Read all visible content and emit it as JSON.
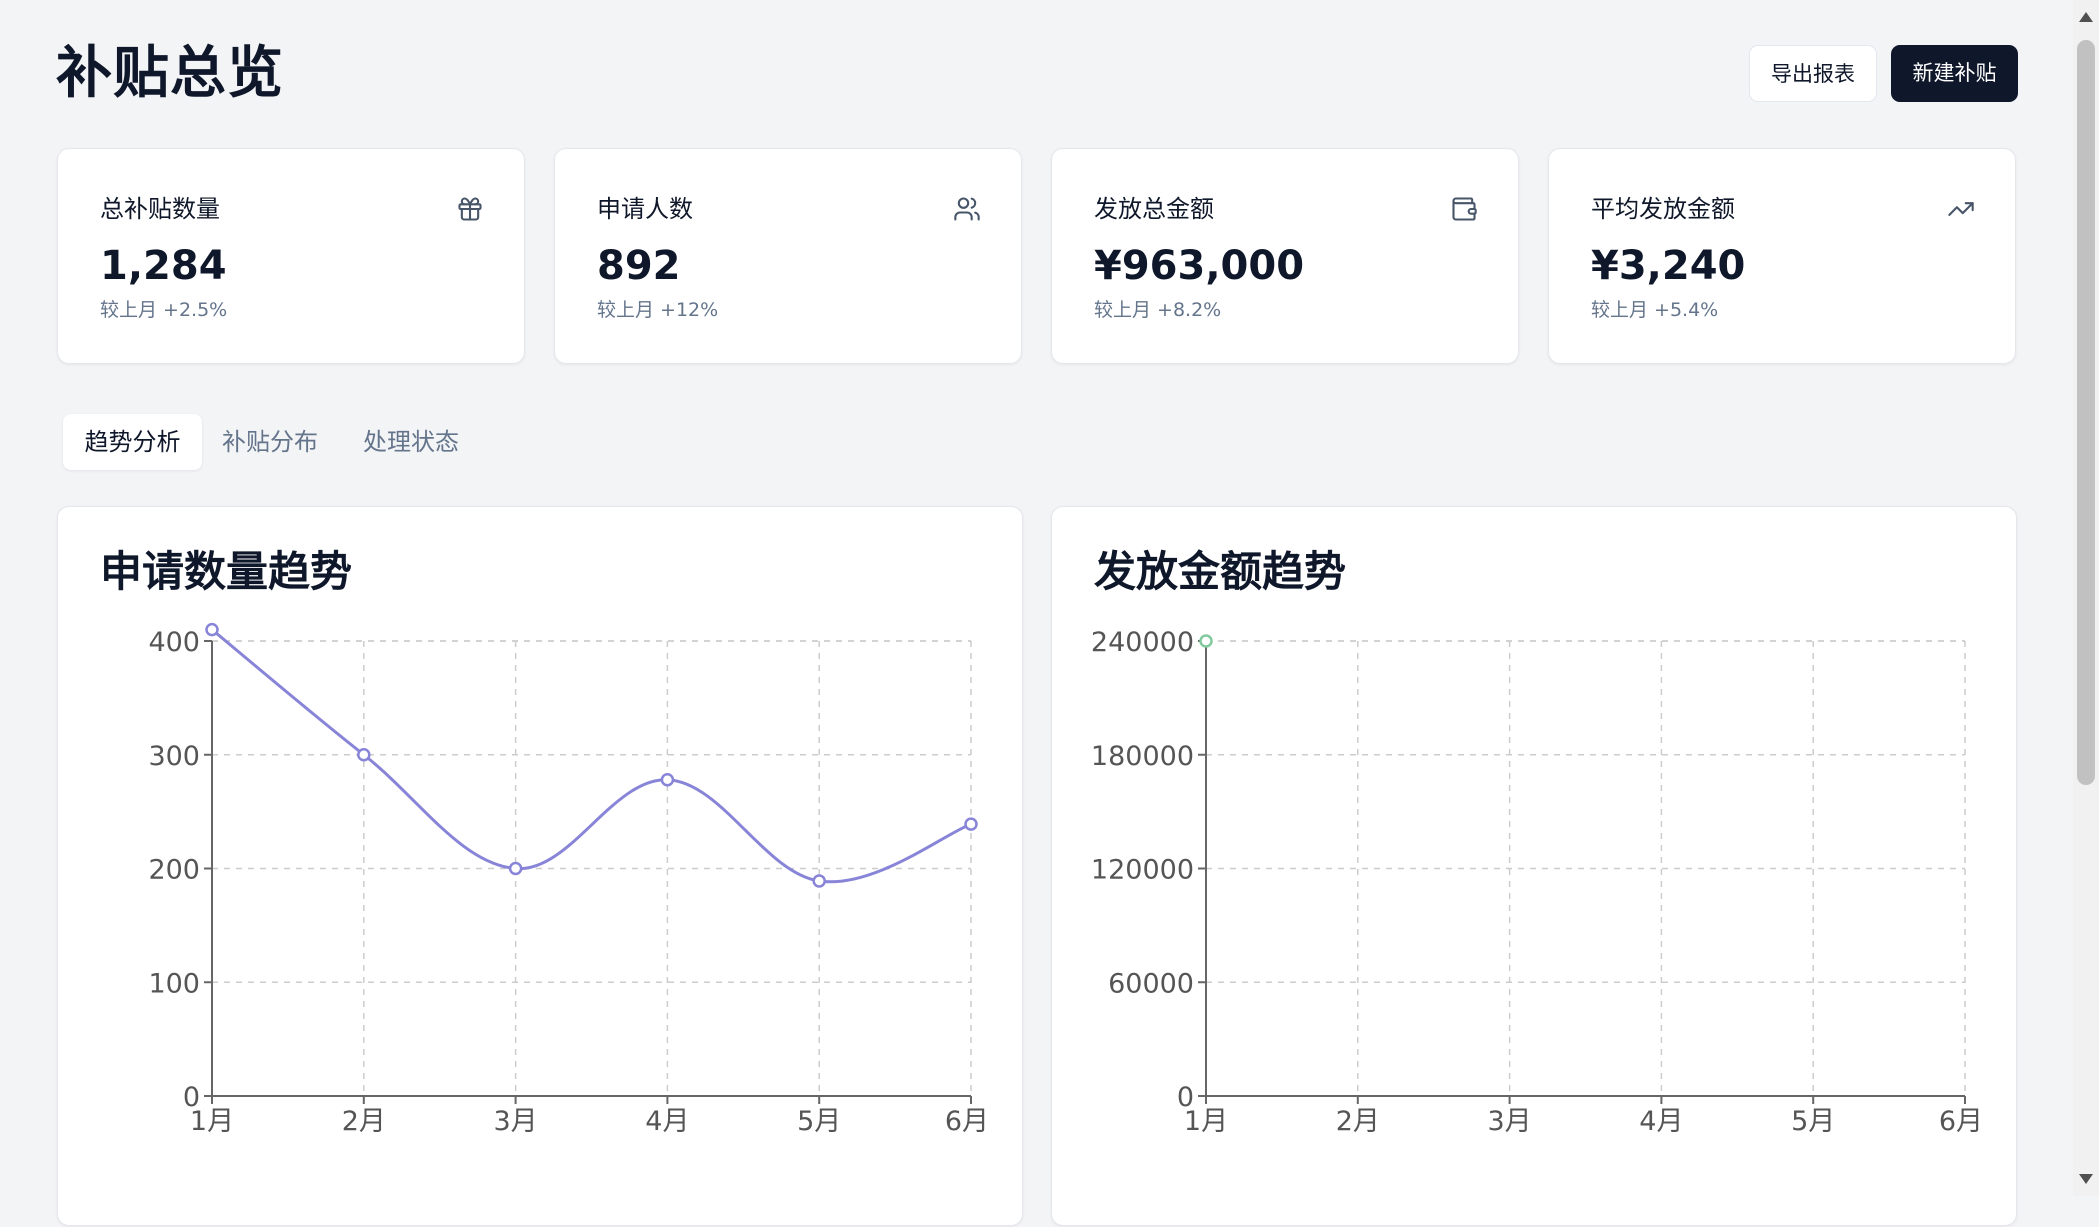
{
  "header": {
    "title": "补贴总览",
    "export_label": "导出报表",
    "new_label": "新建补贴"
  },
  "stats": [
    {
      "label": "总补贴数量",
      "value": "1,284",
      "sub": "较上月 +2.5%",
      "icon": "gift-icon"
    },
    {
      "label": "申请人数",
      "value": "892",
      "sub": "较上月 +12%",
      "icon": "users-icon"
    },
    {
      "label": "发放总金额",
      "value": "¥963,000",
      "sub": "较上月 +8.2%",
      "icon": "wallet-icon"
    },
    {
      "label": "平均发放金额",
      "value": "¥3,240",
      "sub": "较上月 +5.4%",
      "icon": "trending-up-icon"
    }
  ],
  "tabs": [
    {
      "label": "趋势分析",
      "active": true
    },
    {
      "label": "补贴分布",
      "active": false
    },
    {
      "label": "处理状态",
      "active": false
    }
  ],
  "colors": {
    "primary": "#0f172a",
    "muted": "#64748b",
    "series_applications": "#8884d8",
    "series_amount": "#82ca9d"
  },
  "chart_data": [
    {
      "type": "line",
      "title": "申请数量趋势",
      "x": [
        "1月",
        "2月",
        "3月",
        "4月",
        "5月",
        "6月"
      ],
      "series": [
        {
          "values": [
            410,
            300,
            200,
            278,
            189,
            239
          ]
        }
      ],
      "yticks": [
        0,
        100,
        200,
        300,
        400
      ],
      "ylim": [
        0,
        400
      ],
      "grid": true,
      "curve": "smooth"
    },
    {
      "type": "line",
      "title": "发放金额趋势",
      "x": [
        "1月",
        "2月",
        "3月",
        "4月",
        "5月",
        "6月"
      ],
      "series": [
        {
          "values": [
            240000
          ]
        }
      ],
      "yticks": [
        0,
        60000,
        120000,
        180000,
        240000
      ],
      "ylim": [
        0,
        240000
      ],
      "grid": true
    }
  ]
}
